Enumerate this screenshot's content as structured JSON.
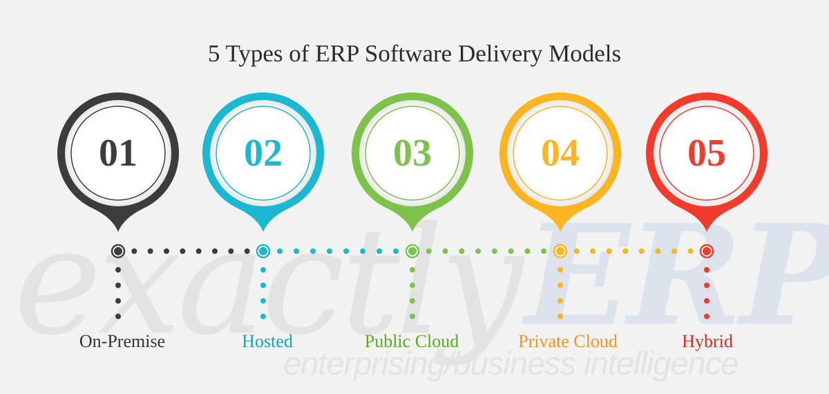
{
  "title": "5 Types of ERP Software Delivery Models",
  "watermark": {
    "brand_light": "exactly",
    "brand_bold": "ERP",
    "tagline": "enterprising/business intelligence"
  },
  "steps": [
    {
      "number": "01",
      "label": "On-Premise",
      "color": "#3c3c3c",
      "label_color": "#333333"
    },
    {
      "number": "02",
      "label": "Hosted",
      "color": "#1bb8d1",
      "label_color": "#14a6bd"
    },
    {
      "number": "03",
      "label": "Public Cloud",
      "color": "#7dc24b",
      "label_color": "#5aab22"
    },
    {
      "number": "04",
      "label": "Private Cloud",
      "color": "#fbb520",
      "label_color": "#f7941d"
    },
    {
      "number": "05",
      "label": "Hybrid",
      "color": "#f23b2b",
      "label_color": "#e02b24"
    }
  ]
}
